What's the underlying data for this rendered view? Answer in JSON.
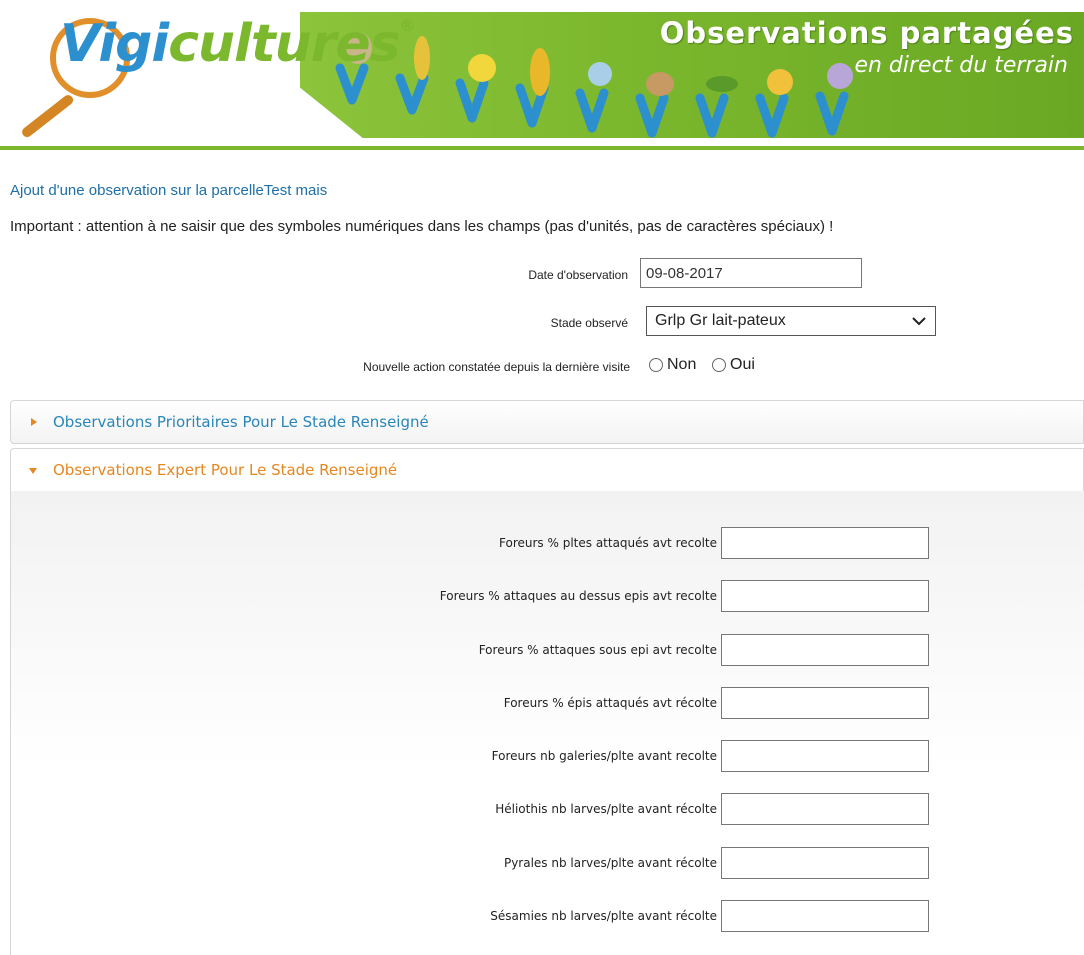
{
  "banner": {
    "brand_part1": "Vigi",
    "brand_part2": "cultures",
    "registered": "®",
    "slogan_line1": "Observations partagées",
    "slogan_line2": "en direct du terrain",
    "colors": {
      "green": "#7cb82e",
      "blue": "#2c8fce",
      "orange": "#e08f2a"
    }
  },
  "form": {
    "heading": "Ajout d'une observation sur la parcelleTest mais",
    "warning": "Important : attention à ne saisir que des symboles numériques dans les champs (pas d'unités, pas de caractères spéciaux) !",
    "date_label": "Date d'observation",
    "date_value": "09-08-2017",
    "stade_label": "Stade observé",
    "stade_selected": "Grlp Gr lait-pateux",
    "action_label": "Nouvelle action constatée depuis la dernière visite",
    "radio_non": "Non",
    "radio_oui": "Oui"
  },
  "accordions": {
    "prioritaires": {
      "label": "Observations Prioritaires Pour Le Stade Renseigné",
      "expanded": false
    },
    "expert": {
      "label": "Observations Expert Pour Le Stade Renseigné",
      "expanded": true
    }
  },
  "expert_fields": [
    {
      "label": "Foreurs % pltes attaqués avt recolte",
      "value": ""
    },
    {
      "label": "Foreurs % attaques au dessus epis avt recolte",
      "value": ""
    },
    {
      "label": "Foreurs % attaques sous epi avt recolte",
      "value": ""
    },
    {
      "label": "Foreurs % épis attaqués avt récolte",
      "value": ""
    },
    {
      "label": "Foreurs nb galeries/plte avant recolte",
      "value": ""
    },
    {
      "label": "Héliothis nb larves/plte avant récolte",
      "value": ""
    },
    {
      "label": "Pyrales nb larves/plte avant récolte",
      "value": ""
    },
    {
      "label": "Sésamies nb larves/plte avant récolte",
      "value": ""
    }
  ]
}
